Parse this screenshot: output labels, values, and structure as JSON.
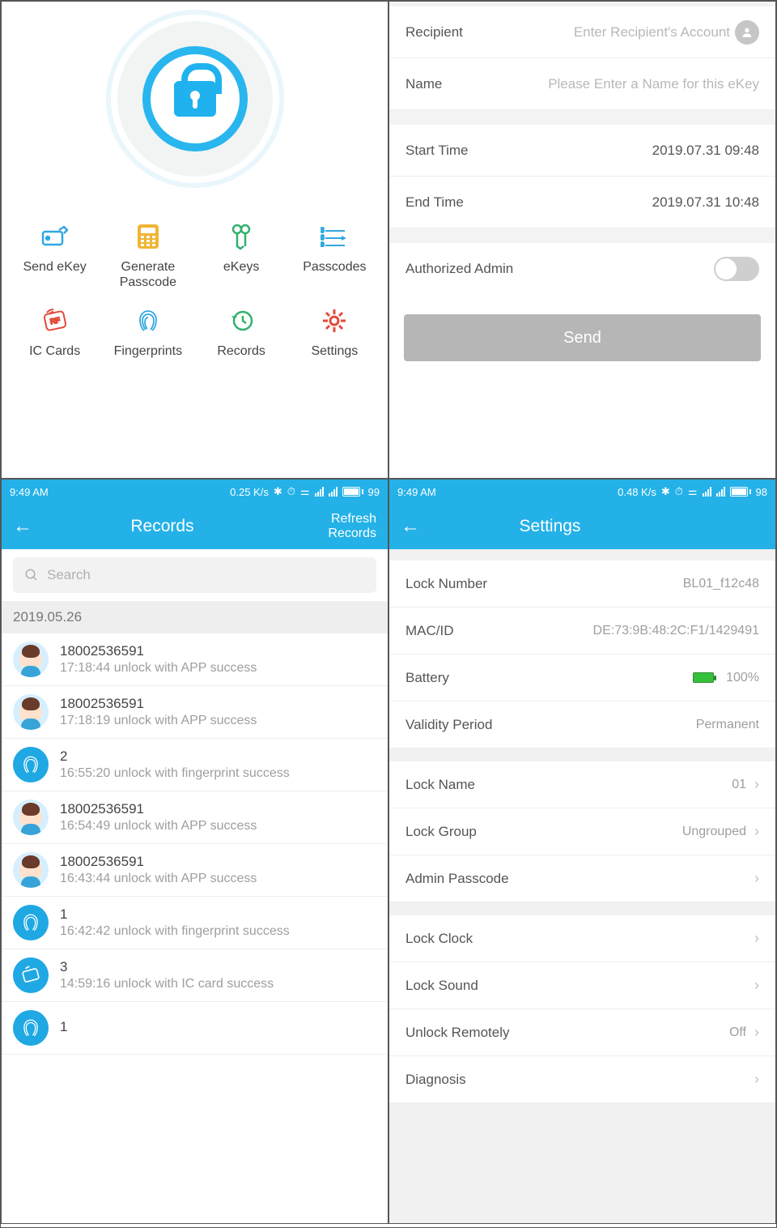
{
  "panel1": {
    "icons": [
      {
        "label": "Send eKey",
        "name": "send-ekey"
      },
      {
        "label": "Generate Passcode",
        "name": "generate-passcode"
      },
      {
        "label": "eKeys",
        "name": "ekeys"
      },
      {
        "label": "Passcodes",
        "name": "passcodes"
      },
      {
        "label": "IC Cards",
        "name": "ic-cards"
      },
      {
        "label": "Fingerprints",
        "name": "fingerprints"
      },
      {
        "label": "Records",
        "name": "records"
      },
      {
        "label": "Settings",
        "name": "settings"
      }
    ]
  },
  "panel2": {
    "recipient_label": "Recipient",
    "recipient_placeholder": "Enter Recipient's Account",
    "name_label": "Name",
    "name_placeholder": "Please Enter a Name for this eKey",
    "start_label": "Start Time",
    "start_val": "2019.07.31  09:48",
    "end_label": "End Time",
    "end_val": "2019.07.31  10:48",
    "admin_label": "Authorized Admin",
    "send": "Send"
  },
  "panel3": {
    "status_time": "9:49 AM",
    "status_net": "0.25 K/s",
    "status_batt": "99",
    "title": "Records",
    "refresh": "Refresh Records",
    "search_placeholder": "Search",
    "date": "2019.05.26",
    "rows": [
      {
        "type": "user",
        "t1": "18002536591",
        "t2": "17:18:44 unlock with APP success"
      },
      {
        "type": "user",
        "t1": "18002536591",
        "t2": "17:18:19 unlock with APP success"
      },
      {
        "type": "finger",
        "t1": "2",
        "t2": "16:55:20 unlock with fingerprint success"
      },
      {
        "type": "user",
        "t1": "18002536591",
        "t2": "16:54:49 unlock with APP success"
      },
      {
        "type": "user",
        "t1": "18002536591",
        "t2": "16:43:44 unlock with APP success"
      },
      {
        "type": "finger",
        "t1": "1",
        "t2": "16:42:42 unlock with fingerprint success"
      },
      {
        "type": "card",
        "t1": "3",
        "t2": "14:59:16 unlock with IC card success"
      },
      {
        "type": "finger",
        "t1": "1",
        "t2": ""
      }
    ]
  },
  "panel4": {
    "status_time": "9:49 AM",
    "status_net": "0.48 K/s",
    "status_batt": "98",
    "title": "Settings",
    "groups": [
      [
        {
          "label": "Lock Number",
          "val": "BL01_f12c48",
          "chev": false
        },
        {
          "label": "MAC/ID",
          "val": "DE:73:9B:48:2C:F1/1429491",
          "chev": false
        },
        {
          "label": "Battery",
          "val": "100%",
          "chev": false,
          "battery": true
        },
        {
          "label": "Validity Period",
          "val": "Permanent",
          "chev": false
        }
      ],
      [
        {
          "label": "Lock Name",
          "val": "01",
          "chev": true
        },
        {
          "label": "Lock Group",
          "val": "Ungrouped",
          "chev": true
        },
        {
          "label": "Admin Passcode",
          "val": "",
          "chev": true
        }
      ],
      [
        {
          "label": "Lock Clock",
          "val": "",
          "chev": true
        },
        {
          "label": "Lock Sound",
          "val": "",
          "chev": true
        },
        {
          "label": "Unlock Remotely",
          "val": "Off",
          "chev": true
        },
        {
          "label": "Diagnosis",
          "val": "",
          "chev": true
        }
      ]
    ]
  }
}
